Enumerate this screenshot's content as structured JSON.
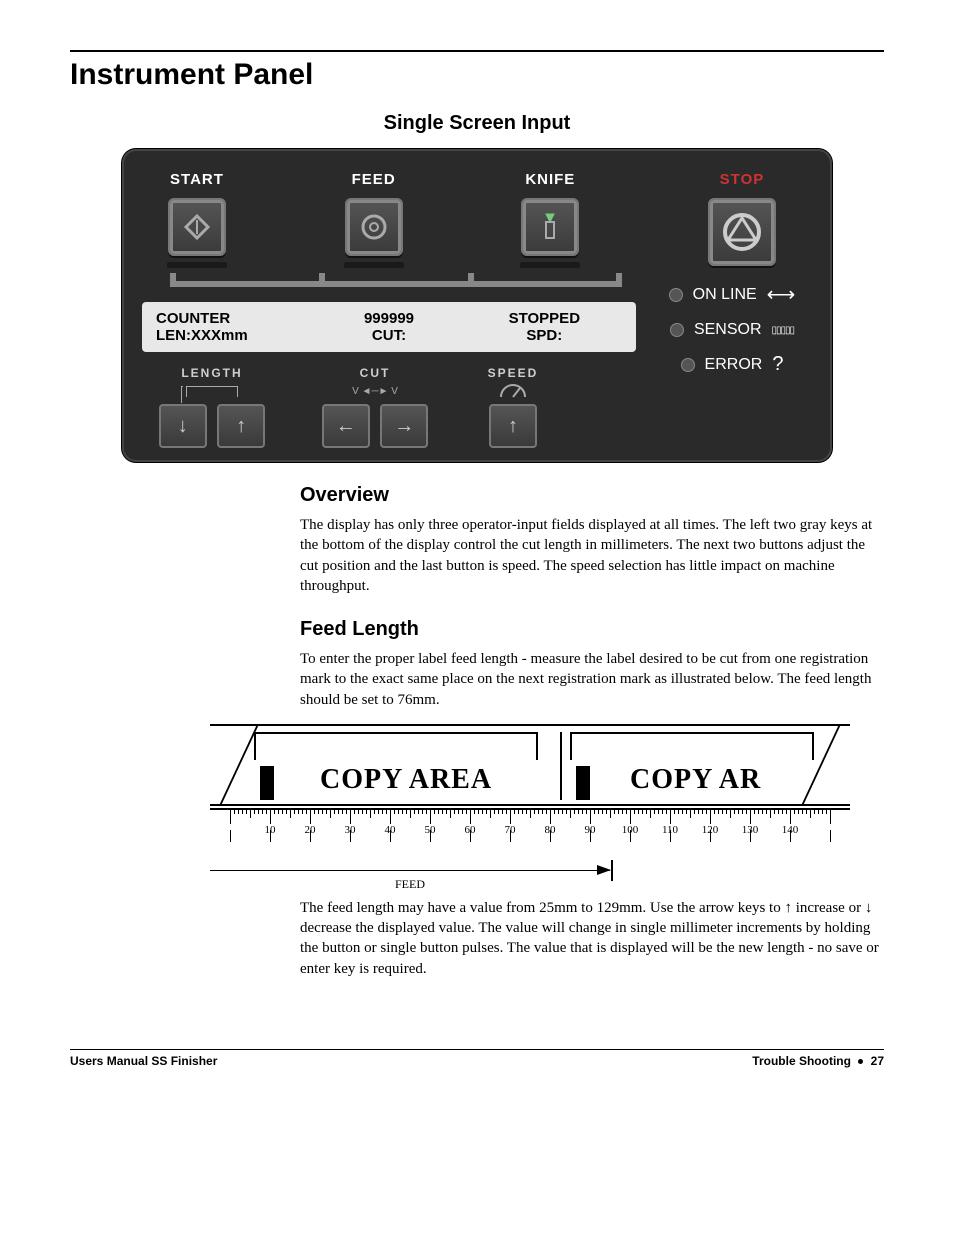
{
  "page": {
    "title": "Instrument Panel",
    "subheading": "Single Screen Input"
  },
  "panel": {
    "buttons": {
      "start": "START",
      "feed": "FEED",
      "knife": "KNIFE",
      "stop": "STOP"
    },
    "lcd": {
      "line1_left": "COUNTER",
      "line1_mid": "999999",
      "line1_right": "STOPPED",
      "line2_left": "LEN:XXXmm",
      "line2_mid": "CUT:",
      "line2_right": "SPD:"
    },
    "status": {
      "online": "ON LINE",
      "sensor": "SENSOR",
      "error": "ERROR"
    },
    "adjust": {
      "length": "LENGTH",
      "cut": "CUT",
      "cut_sub": "V ◄─► V",
      "speed": "SPEED"
    }
  },
  "overview": {
    "heading": "Overview",
    "text": "The display has only three operator-input fields displayed at all times.  The left two gray keys at the bottom of the display control the cut length in millimeters.  The next two buttons adjust the cut position and the last button is speed.  The speed selection has little impact on machine throughput."
  },
  "feed_length": {
    "heading": "Feed Length",
    "intro": "To enter the proper label feed length - measure the label desired to be cut from one registration mark to the exact same place on the next registration mark as illustrated below.  The feed length should be set to 76mm.",
    "diagram": {
      "copy_area_1": "COPY AREA",
      "copy_area_2": "COPY AR",
      "ruler_ticks": [
        10,
        20,
        30,
        40,
        50,
        60,
        70,
        80,
        90,
        100,
        110,
        120,
        130,
        140
      ],
      "feed_label": "FEED"
    },
    "outro_pre": "The feed length may have a value from 25mm to 129mm.  Use the arrow keys to ",
    "outro_inc_sym": "↑",
    "outro_inc": " increase or ",
    "outro_dec_sym": "↓",
    "outro_rest": " decrease the displayed value.  The value will change in single millimeter increments by holding the button or single button pulses.  The value that is displayed will be the new length - no save or enter key is required."
  },
  "footer": {
    "left": "Users Manual SS Finisher",
    "right_section": "Trouble Shooting",
    "right_page": "27"
  }
}
